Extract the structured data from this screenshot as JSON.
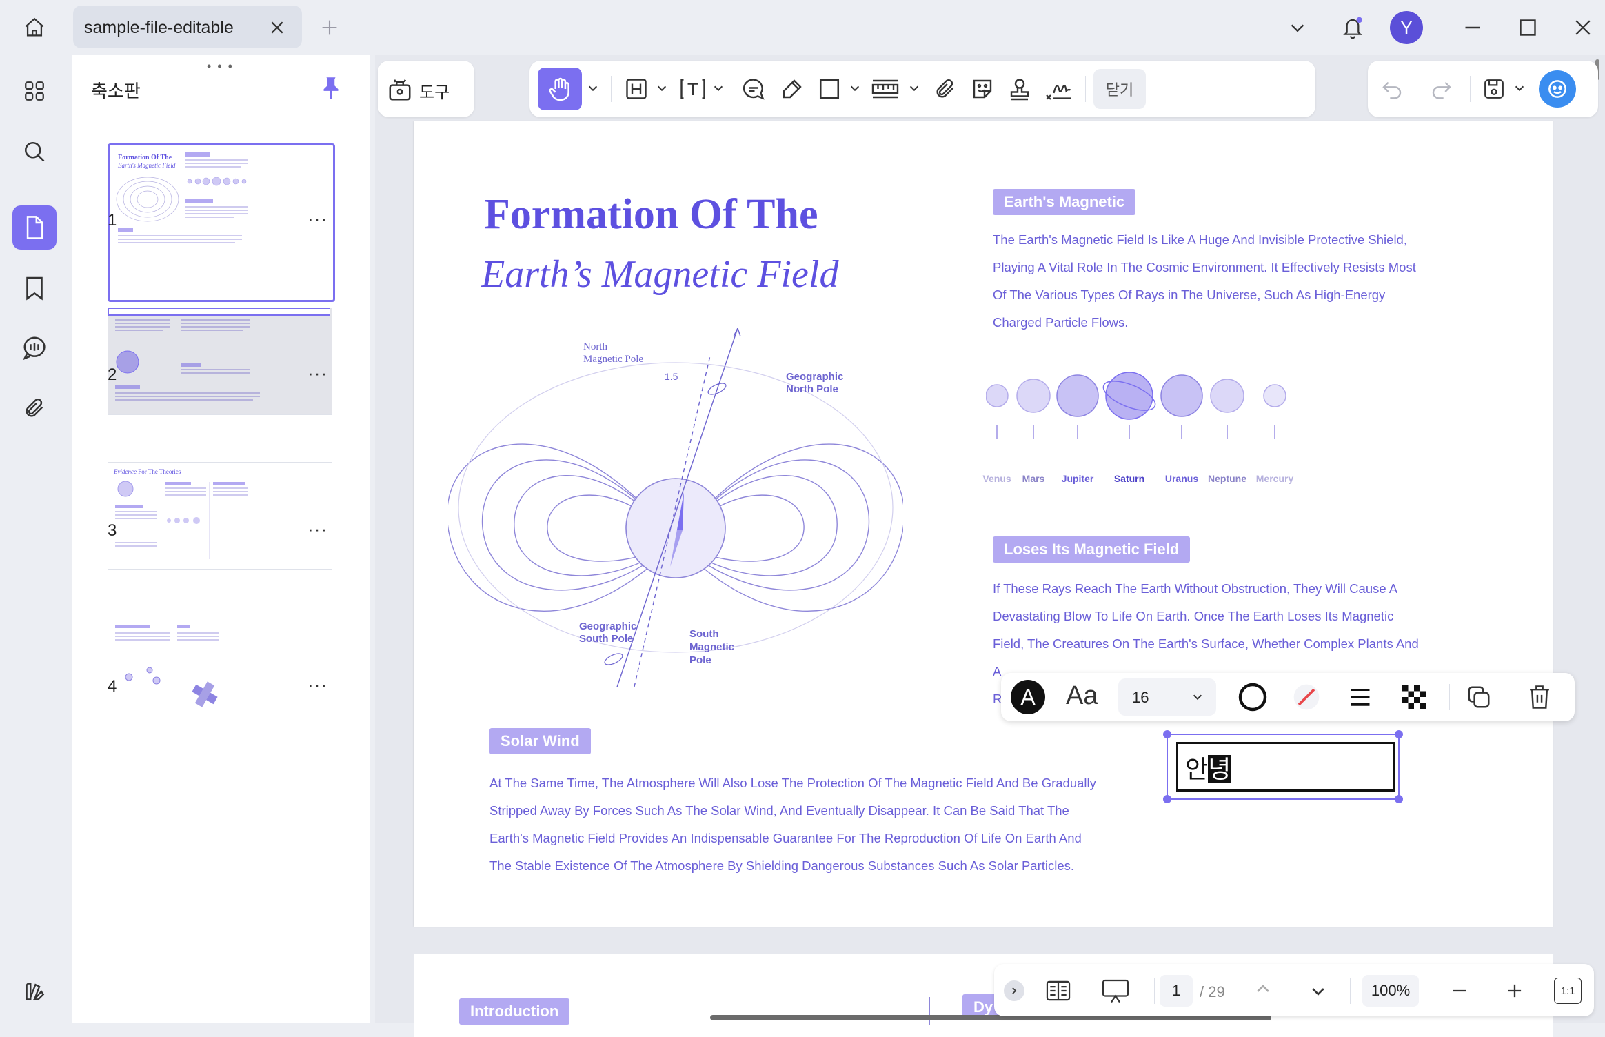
{
  "window": {
    "tab_title": "sample-file-editable",
    "avatar_letter": "Y"
  },
  "sidebar": {
    "panel_title": "축소판",
    "pages": [
      {
        "number": "1",
        "more": "···"
      },
      {
        "number": "2",
        "more": "···"
      },
      {
        "number": "3",
        "more": "···"
      },
      {
        "number": "4",
        "more": "···"
      }
    ],
    "thumb3_title_italic": "Evidence",
    "thumb3_title_rest": " For The Theories"
  },
  "toolbar": {
    "tools_label": "도구",
    "close_label": "닫기"
  },
  "document": {
    "title_line1": "Formation Of The",
    "title_line2": "Earth’s Magnetic Field",
    "diagram": {
      "north_magnetic": [
        "North",
        "Magnetic Pole"
      ],
      "geographic_north": [
        "Geographic",
        "North Pole"
      ],
      "angle": "1.5",
      "geographic_south": [
        "Geographic",
        "South Pole"
      ],
      "south_magnetic": [
        "South",
        "Magnetic",
        "Pole"
      ]
    },
    "section1": {
      "heading": "Earth's Magnetic",
      "lines": [
        "The Earth's Magnetic Field Is Like A Huge And Invisible Protective Shield,",
        "Playing A Vital Role In The Cosmic Environment. It Effectively Resists Most",
        "Of The Various Types Of Rays in The Universe, Such As High-Energy",
        "Charged Particle Flows."
      ]
    },
    "planets": [
      "Venus",
      "Mars",
      "Jupiter",
      "Saturn",
      "Uranus",
      "Neptune",
      "Mercury"
    ],
    "section2": {
      "heading": "Loses Its Magnetic Field",
      "lines": [
        "If These Rays Reach The Earth Without Obstruction, They Will Cause A",
        "Devastating Blow To Life On Earth. Once The Earth Loses Its Magnetic",
        "Field, The Creatures On The Earth's Surface, Whether Complex Plants And",
        "A",
        "R"
      ]
    },
    "section3": {
      "heading": "Solar Wind",
      "lines": [
        "At The Same Time, The Atmosphere Will Also Lose The Protection Of The Magnetic Field And Be Gradually",
        "Stripped Away By Forces Such As The Solar Wind, And Eventually Disappear. It Can Be Said That The",
        "Earth's Magnetic Field Provides An Indispensable Guarantee For The Reproduction Of Life On Earth And",
        "The Stable Existence Of The Atmosphere By Shielding Dangerous Substances Such As Solar Particles."
      ]
    },
    "page2_heading": "Introduction",
    "page2_partial": "Dy"
  },
  "textbox": {
    "text_plain": "안",
    "text_selected": "녕"
  },
  "format_toolbar": {
    "font_glyph": "Aa",
    "font_size": "16"
  },
  "bottom_bar": {
    "current_page": "1",
    "total_pages": "/ 29",
    "zoom": "100%",
    "fit_label": "1:1"
  },
  "colors": {
    "accent": "#7b6ff0",
    "doc_purple": "#5d50e0",
    "heading_pill": "#b3a9f2"
  }
}
